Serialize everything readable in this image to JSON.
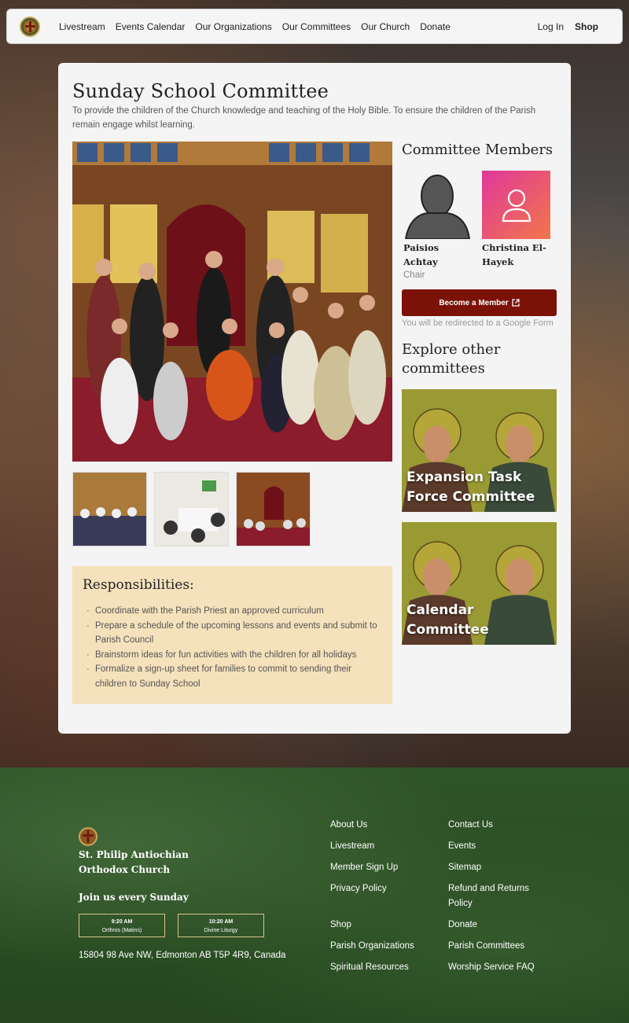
{
  "nav": {
    "links": [
      "Livestream",
      "Events Calendar",
      "Our Organizations",
      "Our Committees",
      "Our Church",
      "Donate"
    ],
    "login": "Log In",
    "shop": "Shop"
  },
  "page": {
    "title": "Sunday School Committee",
    "description": "To provide the children of the Church knowledge and teaching of the Holy Bible. To ensure the children of the Parish remain engage whilst learning."
  },
  "members": {
    "title": "Committee Members",
    "list": [
      {
        "name": "Paisios Achtay",
        "role": "Chair"
      },
      {
        "name": "Christina El-Hayek",
        "role": ""
      }
    ],
    "become_label": "Become a Member",
    "redirect_note": "You will be redirected to a Google Form"
  },
  "explore": {
    "title": "Explore other committees",
    "cards": [
      {
        "label": "Expansion Task Force Committee"
      },
      {
        "label": "Calendar Committee"
      }
    ]
  },
  "responsibilities": {
    "title": "Responsibilities:",
    "items": [
      "Coordinate with the Parish Priest an approved curriculum",
      "Prepare a schedule of the upcoming lessons and events and submit to Parish Council",
      "Brainstorm ideas for fun activities with the children for all holidays",
      "Formalize a sign-up sheet for families to commit to sending their children to Sunday School"
    ]
  },
  "footer": {
    "church_name": "St. Philip Antiochian Orthodox Church",
    "join": "Join us every Sunday",
    "services": [
      {
        "time": "9:20 AM",
        "name": "Orthros (Matins)"
      },
      {
        "time": "10:20 AM",
        "name": "Divine Liturgy"
      }
    ],
    "address": "15804 98 Ave NW, Edmonton AB T5P 4R9, Canada",
    "col1": [
      "About Us",
      "Livestream",
      "Member Sign Up",
      "Privacy Policy",
      "Shop",
      "Parish Organizations",
      "Spiritual Resources"
    ],
    "col2": [
      "Contact Us",
      "Events",
      "Sitemap",
      "Refund and Returns Policy",
      "Donate",
      "Parish Committees",
      "Worship Service FAQ"
    ]
  }
}
